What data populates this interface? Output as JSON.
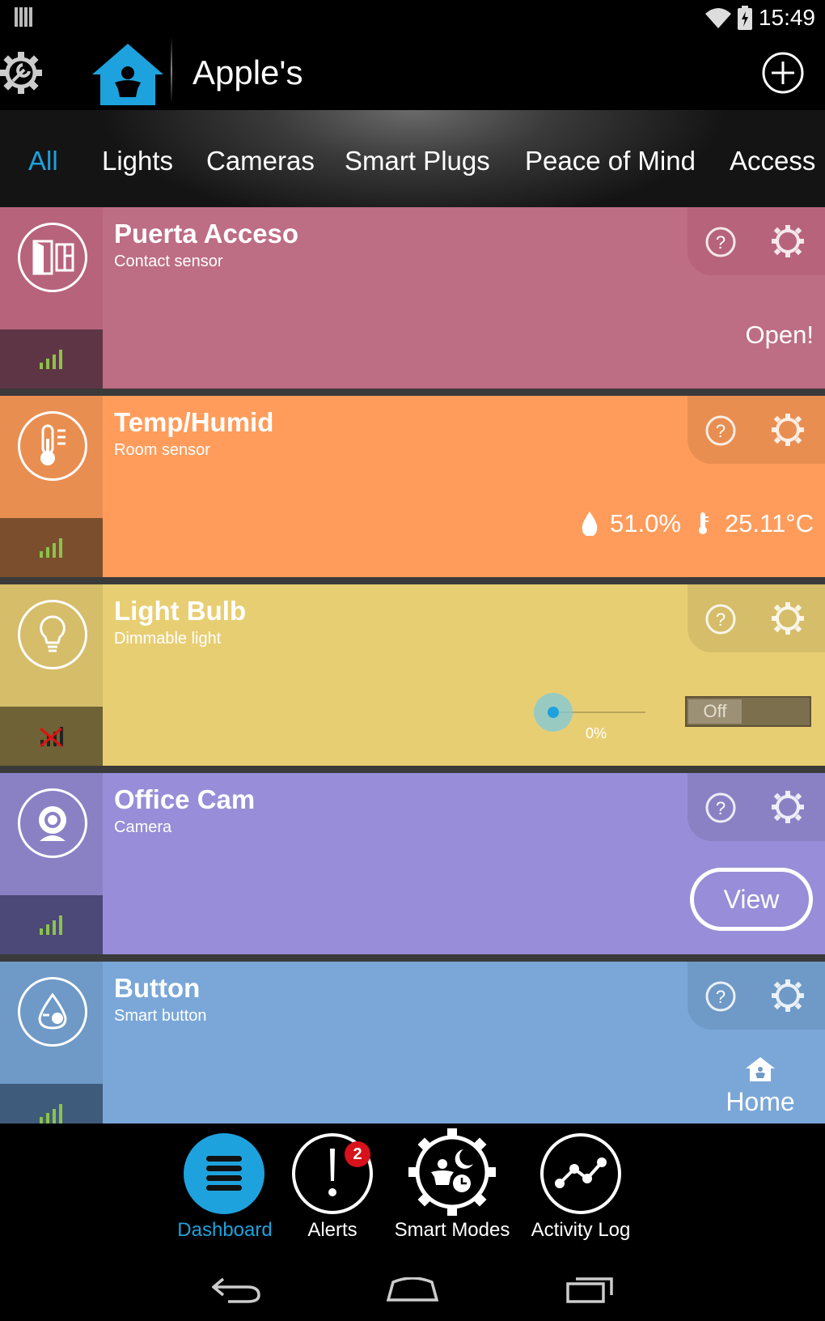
{
  "status_bar": {
    "time": "15:49"
  },
  "header": {
    "title": "Apple's"
  },
  "tabs": [
    "All",
    "Lights",
    "Cameras",
    "Smart Plugs",
    "Peace of Mind",
    "Access"
  ],
  "devices": [
    {
      "name": "Puerta Acceso",
      "type": "Contact sensor",
      "status": "Open!",
      "color": "#bd6d84",
      "side_color": "#b7637c",
      "signal_color": "#5e3544"
    },
    {
      "name": "Temp/Humid",
      "type": "Room sensor",
      "humidity": "51.0%",
      "temperature": "25.11°C",
      "color": "#ff9c5b",
      "side_color": "#e98e51",
      "signal_color": "#7b4f2e"
    },
    {
      "name": "Light Bulb",
      "type": "Dimmable light",
      "dim_value": "0%",
      "toggle": "Off",
      "color": "#e8ce73",
      "side_color": "#d5bd6a",
      "signal_color": "#6e6236"
    },
    {
      "name": "Office Cam",
      "type": "Camera",
      "action": "View",
      "color": "#978dd8",
      "side_color": "#8a81c5",
      "signal_color": "#4c4877"
    },
    {
      "name": "Button",
      "type": "Smart button",
      "mode": "Home",
      "color": "#7aa7d8",
      "side_color": "#6f99c6",
      "signal_color": "#3f5b7b"
    }
  ],
  "bottom_nav": [
    {
      "label": "Dashboard"
    },
    {
      "label": "Alerts",
      "badge": "2"
    },
    {
      "label": "Smart Modes"
    },
    {
      "label": "Activity Log"
    }
  ],
  "colors": {
    "accent": "#1ea2dd",
    "signal_ok": "#8bc34a",
    "badge": "#d8111b"
  }
}
